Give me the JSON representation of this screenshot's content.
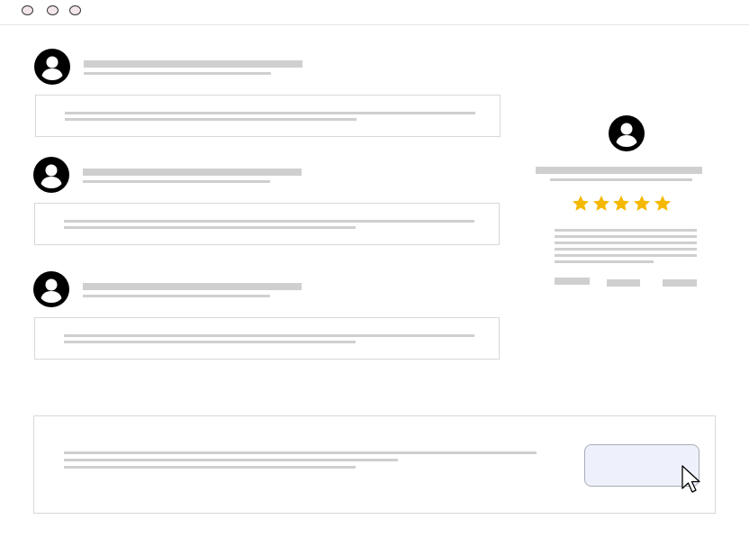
{
  "window": {
    "controls": [
      "close",
      "minimize",
      "maximize"
    ]
  },
  "icons": {
    "avatar": "user-circle-icon",
    "star": "star-icon",
    "cursor": "mouse-pointer-icon"
  },
  "colors": {
    "placeholder": "#cfcfcf",
    "star": "#f5b800",
    "button_fill": "#eef1fb",
    "avatar": "#000000"
  },
  "feed": {
    "items": [
      {
        "kind": "comment-card"
      },
      {
        "kind": "comment-card"
      },
      {
        "kind": "comment-card"
      }
    ]
  },
  "profile_card": {
    "rating": 5,
    "rating_max": 5
  },
  "composer": {
    "submit_button_label": ""
  }
}
